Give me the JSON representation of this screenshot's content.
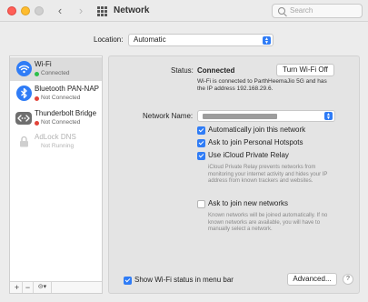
{
  "window": {
    "title": "Network",
    "search_placeholder": "Search"
  },
  "location": {
    "label": "Location:",
    "value": "Automatic"
  },
  "sidebar": {
    "items": [
      {
        "name": "Wi-Fi",
        "status": "Connected",
        "icon": "wifi-icon",
        "status_color": "#2fbf4a"
      },
      {
        "name": "Bluetooth PAN-NAP",
        "status": "Not Connected",
        "icon": "bluetooth-icon",
        "status_color": "#e2443a"
      },
      {
        "name": "Thunderbolt Bridge",
        "status": "Not Connected",
        "icon": "thunderbolt-bridge-icon",
        "status_color": "#e2443a"
      },
      {
        "name": "AdLock DNS",
        "status": "Not Running",
        "icon": "lock-icon",
        "status_color": ""
      }
    ],
    "footer": {
      "add": "+",
      "remove": "−",
      "action": "⊝▾"
    }
  },
  "detail": {
    "status_label": "Status:",
    "status_value": "Connected",
    "turn_off_button": "Turn Wi-Fi Off",
    "status_description": "Wi-Fi is connected to ParthHeemaJio 5G and has the IP address 192.168.29.6.",
    "network_name_label": "Network Name:",
    "options": {
      "auto_join": {
        "label": "Automatically join this network",
        "checked": true
      },
      "ask_hotspots": {
        "label": "Ask to join Personal Hotspots",
        "checked": true
      },
      "private_relay": {
        "label": "Use iCloud Private Relay",
        "checked": true
      },
      "private_relay_help": "iCloud Private Relay prevents networks from monitoring your internet activity and hides your IP address from known trackers and websites.",
      "ask_new_networks": {
        "label": "Ask to join new networks",
        "checked": false
      },
      "ask_new_networks_help": "Known networks will be joined automatically. If no known networks are available, you will have to manually select a network."
    },
    "show_status_menu_bar": {
      "label": "Show Wi-Fi status in menu bar",
      "checked": true
    },
    "advanced_button": "Advanced...",
    "help_button": "?"
  },
  "colors": {
    "accent": "#2f7cf6",
    "connected": "#2fbf4a",
    "not_connected": "#e2443a"
  }
}
